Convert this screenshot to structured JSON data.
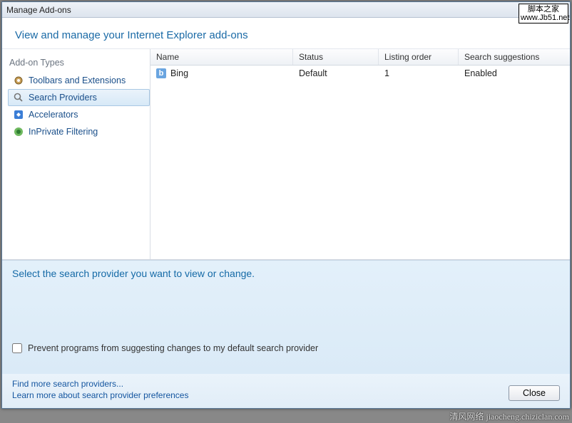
{
  "window": {
    "title": "Manage Add-ons"
  },
  "watermark_top": {
    "line1": "脚本之家",
    "line2": "www.Jb51.net"
  },
  "instruction": "View and manage your Internet Explorer add-ons",
  "sidebar": {
    "heading": "Add-on Types",
    "items": [
      {
        "label": "Toolbars and Extensions",
        "selected": false
      },
      {
        "label": "Search Providers",
        "selected": true
      },
      {
        "label": "Accelerators",
        "selected": false
      },
      {
        "label": "InPrivate Filtering",
        "selected": false
      }
    ]
  },
  "columns": {
    "name": "Name",
    "status": "Status",
    "order": "Listing order",
    "sugg": "Search suggestions"
  },
  "rows": [
    {
      "name": "Bing",
      "status": "Default",
      "order": "1",
      "sugg": "Enabled"
    }
  ],
  "details": {
    "heading": "Select the search provider you want to view or change.",
    "prevent_label": "Prevent programs from suggesting changes to my default search provider",
    "prevent_checked": false
  },
  "footer": {
    "link_find": "Find more search providers...",
    "link_learn": "Learn more about search provider preferences",
    "close_label": "Close"
  },
  "watermark_bottom": "清风网络 jiaocheng.chiziclan.com"
}
